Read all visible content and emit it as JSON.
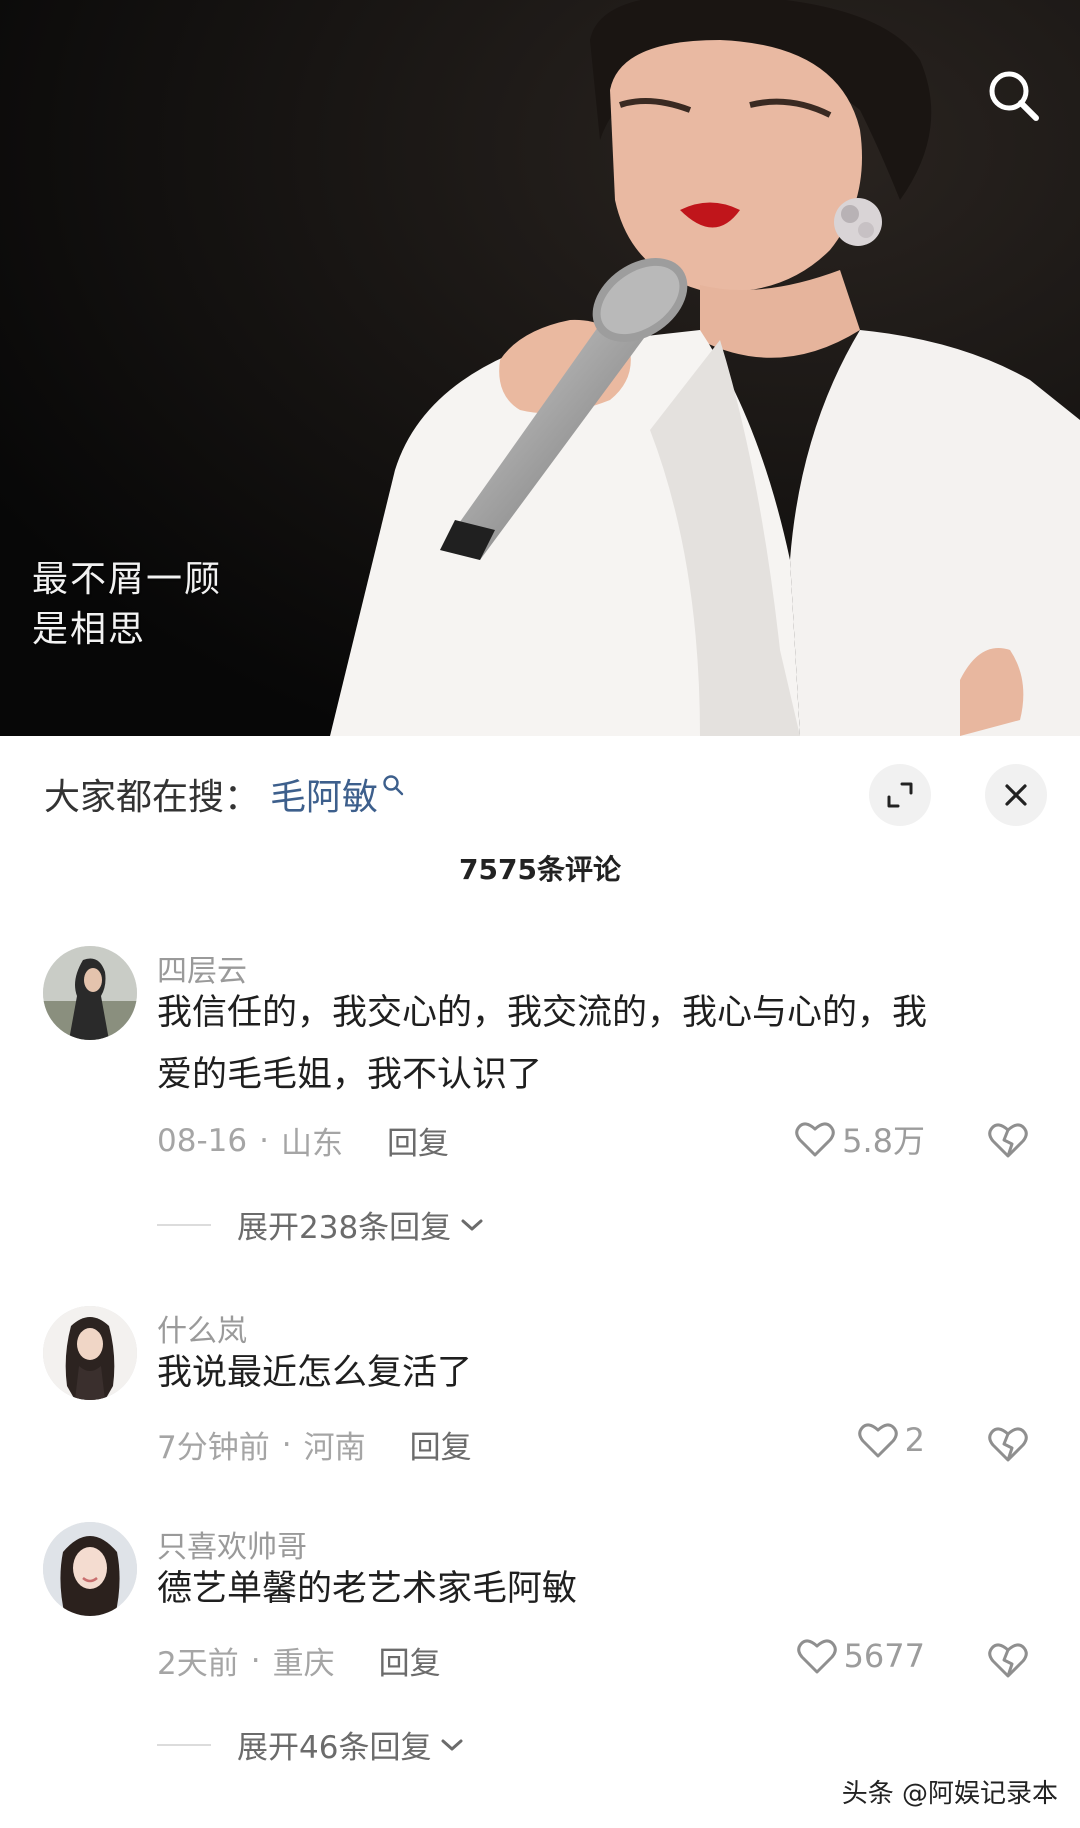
{
  "video": {
    "lyrics_line1": "最不屑一顾",
    "lyrics_line2": "是相思",
    "search_icon": "search-icon"
  },
  "sheet": {
    "trend_prefix": "大家都在搜：",
    "trend_keyword": "毛阿敏",
    "comment_count": "7575条评论",
    "expand_icon": "expand-icon",
    "close_icon": "close-icon"
  },
  "comments": [
    {
      "user": "四层云",
      "text_line1": "我信任的，我交心的，我交流的，我心与心的，我",
      "text_line2": "爱的毛毛姐，我不认识了",
      "date": "08-16",
      "location": "山东",
      "reply": "回复",
      "likes": "5.8万",
      "expand": "展开238条回复"
    },
    {
      "user": "什么岚",
      "text_line1": "我说最近怎么复活了",
      "date": "7分钟前",
      "location": "河南",
      "reply": "回复",
      "likes": "2"
    },
    {
      "user": "只喜欢帅哥",
      "text_line1": "德艺单馨的老艺术家毛阿敏",
      "date": "2天前",
      "location": "重庆",
      "reply": "回复",
      "likes": "5677",
      "expand": "展开46条回复"
    }
  ],
  "dot_separator": "·",
  "watermark": "头条 @阿娱记录本",
  "colors": {
    "keyword": "#3d5f8c",
    "meta": "#a5a5a5",
    "text": "#1f1f1f"
  }
}
